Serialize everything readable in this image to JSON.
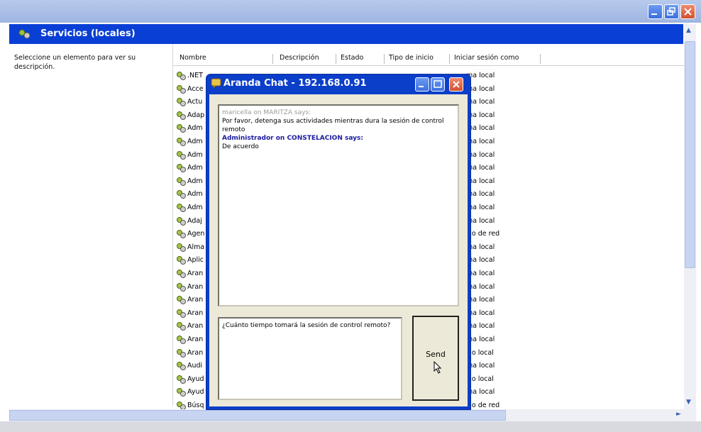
{
  "window": {
    "panel_title": "Servicios (locales)",
    "description_hint": "Seleccione un elemento para ver su descripción."
  },
  "columns": [
    "Nombre",
    "Descripción",
    "Estado",
    "Tipo de inicio",
    "Iniciar sesión como"
  ],
  "rows": [
    {
      "name": ".NET",
      "login": "ma local"
    },
    {
      "name": "Acce",
      "login": "ma local"
    },
    {
      "name": "Actu",
      "login": "ma local"
    },
    {
      "name": "Adap",
      "login": "ma local"
    },
    {
      "name": "Adm",
      "login": "ma local"
    },
    {
      "name": "Adm",
      "login": "ma local"
    },
    {
      "name": "Adm",
      "login": "ma local"
    },
    {
      "name": "Adm",
      "login": "ma local"
    },
    {
      "name": "Adm",
      "login": "ma local"
    },
    {
      "name": "Adm",
      "login": "ma local"
    },
    {
      "name": "Adm",
      "login": "ma local"
    },
    {
      "name": "Adaj",
      "login": "ma local"
    },
    {
      "name": "Agen",
      "login": "cio de red"
    },
    {
      "name": "Alma",
      "login": "ma local"
    },
    {
      "name": "Aplic",
      "login": "ma local"
    },
    {
      "name": "Aran",
      "login": "ma local"
    },
    {
      "name": "Aran",
      "login": "ma local"
    },
    {
      "name": "Aran",
      "login": "ma local"
    },
    {
      "name": "Aran",
      "login": "ma local"
    },
    {
      "name": "Aran",
      "login": "ma local"
    },
    {
      "name": "Aran",
      "login": "ma local"
    },
    {
      "name": "Aran",
      "login": "cio local"
    },
    {
      "name": "Audi",
      "login": "ma local"
    },
    {
      "name": "Ayud",
      "login": "cio local"
    },
    {
      "name": "Ayud",
      "login": "ma local"
    },
    {
      "name": "Búsq",
      "login": "cio de red"
    }
  ],
  "chat": {
    "title": "Aranda Chat - 192.168.0.91",
    "messages": {
      "m1": "maricella on MARITZA says:",
      "m2": "Por favor, detenga sus actividades mientras dura la sesión de control remoto",
      "m3": "Administrador on CONSTELACION says:",
      "m4": "De acuerdo"
    },
    "input_value": "¿Cuánto tiempo tomará la sesión de control remoto?",
    "send_label": "Send"
  }
}
